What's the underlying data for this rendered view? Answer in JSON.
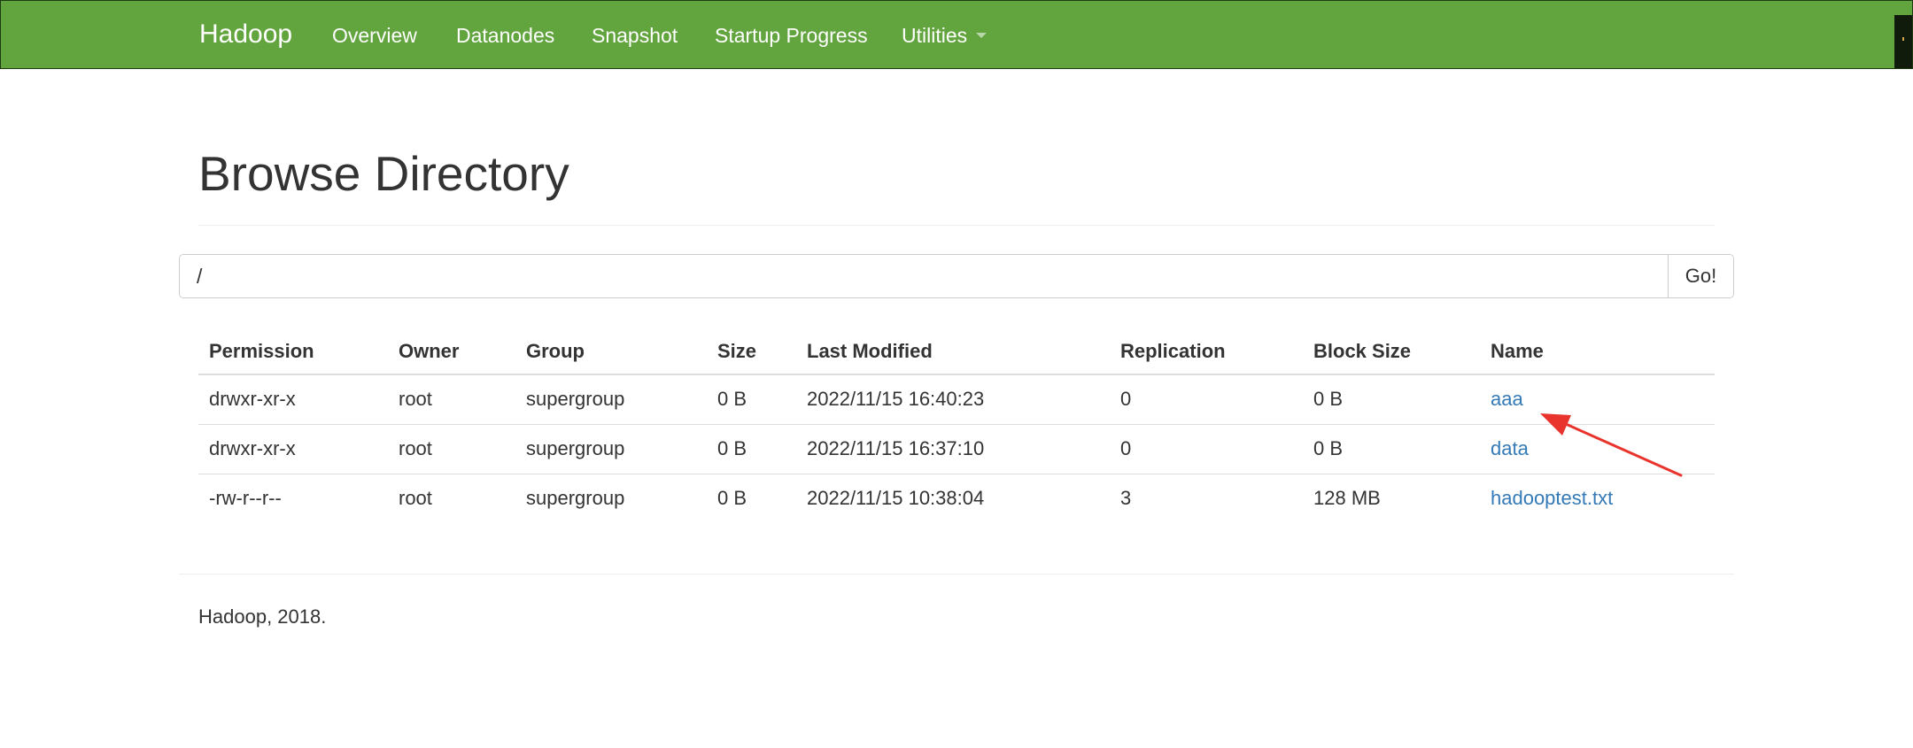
{
  "navbar": {
    "brand": "Hadoop",
    "items": [
      {
        "label": "Overview"
      },
      {
        "label": "Datanodes"
      },
      {
        "label": "Snapshot"
      },
      {
        "label": "Startup Progress"
      },
      {
        "label": "Utilities",
        "has_dropdown": true
      }
    ],
    "color": "#62a43e"
  },
  "page": {
    "title": "Browse Directory"
  },
  "path_search": {
    "value": "/",
    "go_label": "Go!"
  },
  "table": {
    "columns": [
      "Permission",
      "Owner",
      "Group",
      "Size",
      "Last Modified",
      "Replication",
      "Block Size",
      "Name"
    ],
    "rows": [
      {
        "permission": "drwxr-xr-x",
        "owner": "root",
        "group": "supergroup",
        "size": "0 B",
        "last_modified": "2022/11/15 16:40:23",
        "replication": "0",
        "block_size": "0 B",
        "name": "aaa"
      },
      {
        "permission": "drwxr-xr-x",
        "owner": "root",
        "group": "supergroup",
        "size": "0 B",
        "last_modified": "2022/11/15 16:37:10",
        "replication": "0",
        "block_size": "0 B",
        "name": "data"
      },
      {
        "permission": "-rw-r--r--",
        "owner": "root",
        "group": "supergroup",
        "size": "0 B",
        "last_modified": "2022/11/15 10:38:04",
        "replication": "3",
        "block_size": "128 MB",
        "name": "hadooptest.txt"
      }
    ],
    "link_color": "#337ab7"
  },
  "annotation": {
    "arrow_color": "#e8342c"
  },
  "footer": {
    "text": "Hadoop, 2018."
  }
}
